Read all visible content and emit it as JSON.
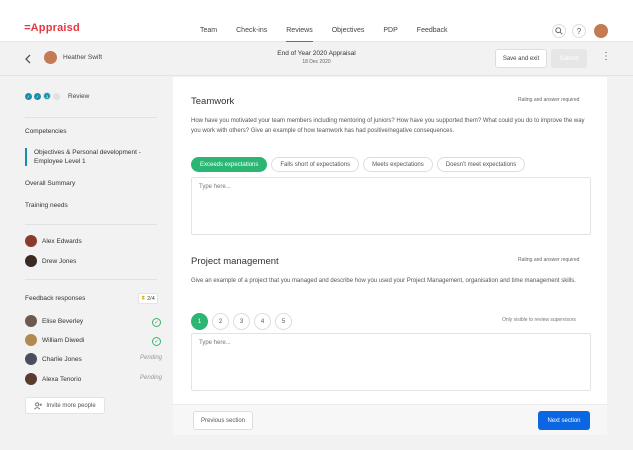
{
  "app": {
    "logo": "Appraisd"
  },
  "nav": {
    "items": [
      "Team",
      "Check-ins",
      "Reviews",
      "Objectives",
      "PDP",
      "Feedback"
    ],
    "active_index": 2
  },
  "header": {
    "user_name": "Heather Swift",
    "title": "End of Year 2020 Appraisal",
    "date": "18 Dec 2020",
    "save_exit": "Save and exit",
    "submit": "Submit"
  },
  "progress": {
    "current_step": "3",
    "label": "Review"
  },
  "sidebar": {
    "competencies": "Competencies",
    "objectives": "Objectives & Personal development - Employee Level 1",
    "overall": "Overall Summary",
    "training": "Training needs",
    "reviewers": [
      "Alex Edwards",
      "Drew Jones"
    ],
    "feedback_title": "Feedback responses",
    "feedback_count": "2/4",
    "feedback": [
      {
        "name": "Elise Beverley",
        "status": "done"
      },
      {
        "name": "William Diwedi",
        "status": "done"
      },
      {
        "name": "Charlie Jones",
        "status": "Pending"
      },
      {
        "name": "Alexa Tenorio",
        "status": "Pending"
      }
    ],
    "invite": "Invite more people"
  },
  "teamwork": {
    "title": "Teamwork",
    "req": "Rating and answer required",
    "question": "How have you motivated your team members including mentoring of juniors? How have you supported them? What could you do to improve the way you work with others? Give an example of how teamwork has had positive/negative consequences.",
    "options": [
      "Exceeds expectations",
      "Falls short of expectations",
      "Meets expectations",
      "Doesn't meet expectations"
    ],
    "selected": 0,
    "placeholder": "Type here..."
  },
  "project": {
    "title": "Project management",
    "req": "Rating and answer required",
    "question": "Give an example of a project that you managed and describe how you used your Project Management, organisation and time management skills.",
    "ratings": [
      "1",
      "2",
      "3",
      "4",
      "5"
    ],
    "selected": 0,
    "visibility": "Only visible to review supervisors",
    "placeholder": "Type here..."
  },
  "footer": {
    "prev": "Previous section",
    "next": "Next section"
  },
  "colors": {
    "brand": "#e4373f",
    "accent": "#1a8ea8",
    "success": "#2bb673",
    "primary": "#0a66e2"
  }
}
